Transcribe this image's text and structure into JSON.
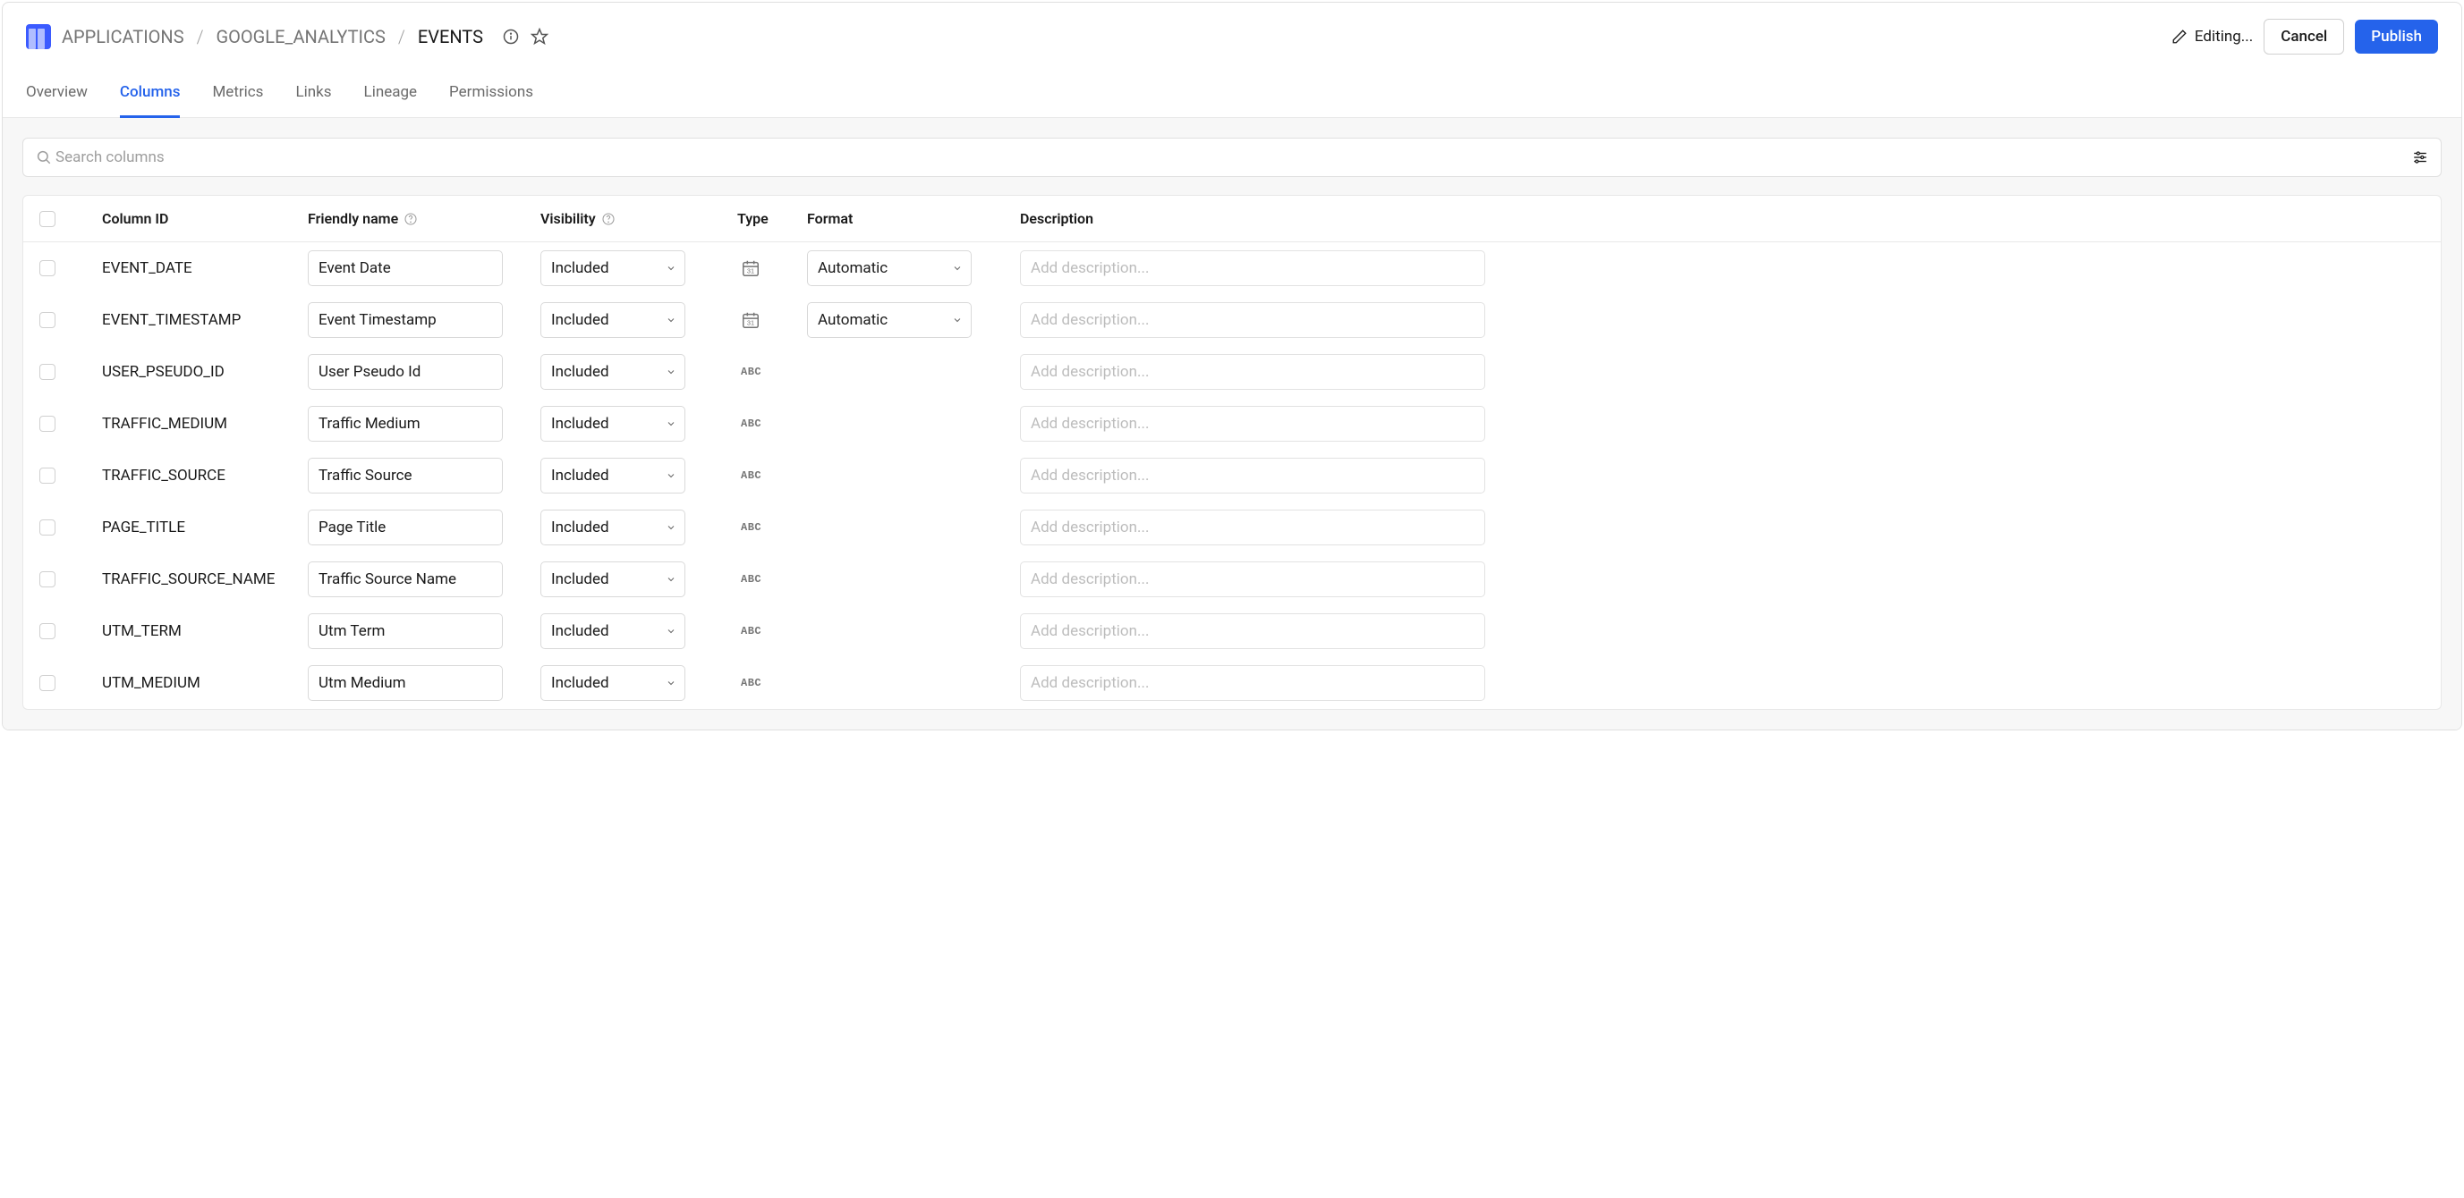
{
  "breadcrumbs": {
    "level1": "APPLICATIONS",
    "level2": "GOOGLE_ANALYTICS",
    "level3": "EVENTS"
  },
  "header": {
    "editing_label": "Editing...",
    "cancel_label": "Cancel",
    "publish_label": "Publish"
  },
  "tabs": {
    "overview": "Overview",
    "columns": "Columns",
    "metrics": "Metrics",
    "links": "Links",
    "lineage": "Lineage",
    "permissions": "Permissions"
  },
  "search": {
    "placeholder": "Search columns"
  },
  "table": {
    "headers": {
      "column_id": "Column ID",
      "friendly_name": "Friendly name",
      "visibility": "Visibility",
      "type": "Type",
      "format": "Format",
      "description": "Description"
    },
    "description_placeholder": "Add description...",
    "rows": [
      {
        "id": "EVENT_DATE",
        "friendly_name": "Event Date",
        "visibility": "Included",
        "type": "date",
        "format": "Automatic"
      },
      {
        "id": "EVENT_TIMESTAMP",
        "friendly_name": "Event Timestamp",
        "visibility": "Included",
        "type": "date",
        "format": "Automatic"
      },
      {
        "id": "USER_PSEUDO_ID",
        "friendly_name": "User Pseudo Id",
        "visibility": "Included",
        "type": "text",
        "format": ""
      },
      {
        "id": "TRAFFIC_MEDIUM",
        "friendly_name": "Traffic Medium",
        "visibility": "Included",
        "type": "text",
        "format": ""
      },
      {
        "id": "TRAFFIC_SOURCE",
        "friendly_name": "Traffic Source",
        "visibility": "Included",
        "type": "text",
        "format": ""
      },
      {
        "id": "PAGE_TITLE",
        "friendly_name": "Page Title",
        "visibility": "Included",
        "type": "text",
        "format": ""
      },
      {
        "id": "TRAFFIC_SOURCE_NAME",
        "friendly_name": "Traffic Source Name",
        "visibility": "Included",
        "type": "text",
        "format": ""
      },
      {
        "id": "UTM_TERM",
        "friendly_name": "Utm Term",
        "visibility": "Included",
        "type": "text",
        "format": ""
      },
      {
        "id": "UTM_MEDIUM",
        "friendly_name": "Utm Medium",
        "visibility": "Included",
        "type": "text",
        "format": ""
      }
    ]
  }
}
